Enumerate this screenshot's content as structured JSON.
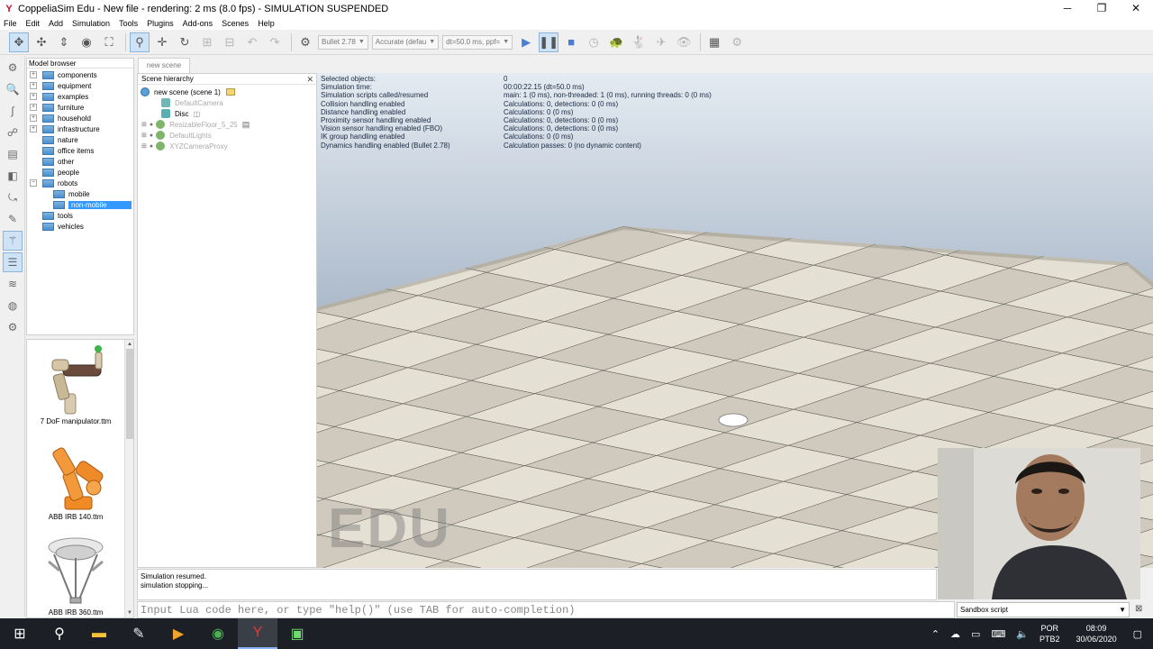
{
  "window": {
    "title": "CoppeliaSim Edu - New file - rendering: 2 ms (8.0 fps) - SIMULATION SUSPENDED",
    "minimize": "─",
    "maximize": "❐",
    "close": "✕"
  },
  "menu": [
    "File",
    "Edit",
    "Add",
    "Simulation",
    "Tools",
    "Plugins",
    "Add-ons",
    "Scenes",
    "Help"
  ],
  "toolbar": {
    "engine": "Bullet 2.78",
    "accuracy": "Accurate (defau",
    "timestep": "dt=50.0 ms, ppf="
  },
  "model_browser": {
    "title": "Model browser",
    "items": [
      {
        "label": "components"
      },
      {
        "label": "equipment"
      },
      {
        "label": "examples"
      },
      {
        "label": "furniture"
      },
      {
        "label": "household"
      },
      {
        "label": "infrastructure"
      },
      {
        "label": "nature"
      },
      {
        "label": "office items"
      },
      {
        "label": "other"
      },
      {
        "label": "people"
      },
      {
        "label": "robots"
      },
      {
        "label": "mobile"
      },
      {
        "label": "non-mobile"
      },
      {
        "label": "tools"
      },
      {
        "label": "vehicles"
      }
    ],
    "thumbnails": [
      {
        "caption": "7 DoF manipulator.ttm"
      },
      {
        "caption": "ABB IRB 140.ttm"
      },
      {
        "caption": "ABB IRB 360.ttm"
      }
    ]
  },
  "scene_tab": "new scene",
  "hierarchy": {
    "title": "Scene hierarchy",
    "items": [
      {
        "label": "new scene (scene 1)"
      },
      {
        "label": "DefaultCamera"
      },
      {
        "label": "Disc"
      },
      {
        "label": "ResizableFloor_5_25"
      },
      {
        "label": "DefaultLights"
      },
      {
        "label": "XYZCameraProxy"
      }
    ]
  },
  "sim_info": {
    "labels": [
      "Selected objects:",
      "Simulation time:",
      "Simulation scripts called/resumed",
      "Collision handling enabled",
      "Distance handling enabled",
      "Proximity sensor handling enabled",
      "Vision sensor handling enabled (FBO)",
      "IK group handling enabled",
      "Dynamics handling enabled (Bullet 2.78)"
    ],
    "values": [
      "0",
      "00:00:22.15 (dt=50.0 ms)",
      "main: 1 (0 ms), non-threaded: 1 (0 ms), running threads: 0 (0 ms)",
      "Calculations: 0, detections: 0 (0 ms)",
      "Calculations: 0 (0 ms)",
      "Calculations: 0, detections: 0 (0 ms)",
      "Calculations: 0, detections: 0 (0 ms)",
      "Calculations: 0 (0 ms)",
      "Calculation passes: 0 (no dynamic content)"
    ]
  },
  "watermark": "EDU",
  "console": [
    "Simulation resumed.",
    "simulation stopping..."
  ],
  "lua_input": {
    "placeholder": "Input Lua code here, or type \"help()\" (use TAB for auto-completion)"
  },
  "sandbox": "Sandbox script",
  "taskbar": {
    "lang1": "POR",
    "lang2": "PTB2",
    "time": "08:09",
    "date": "30/06/2020"
  }
}
